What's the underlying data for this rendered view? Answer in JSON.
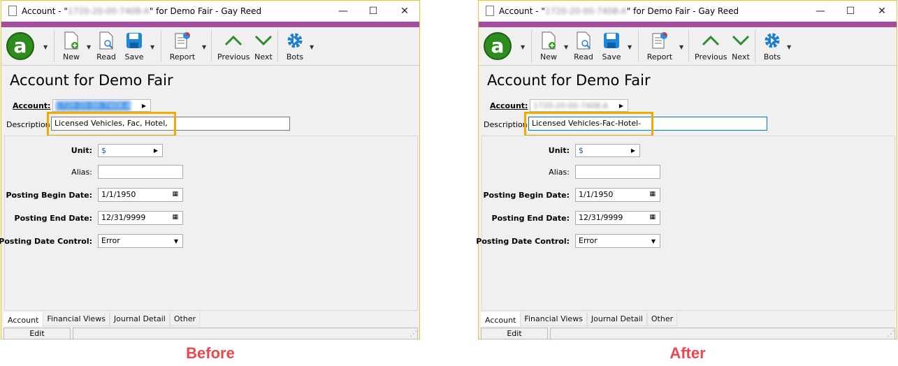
{
  "windows": [
    {
      "title_prefix": "Account - \"",
      "title_account": "1720-20-00-7408-A",
      "title_suffix": "\" for Demo Fair - Gay Reed",
      "toolbar": {
        "new": "New",
        "read": "Read",
        "save": "Save",
        "report": "Report",
        "previous": "Previous",
        "next": "Next",
        "bots": "Bots"
      },
      "heading": "Account for Demo Fair",
      "account_label": "Account:",
      "account_value": "1720-20-00-7408-A",
      "description_label": "Description:",
      "description_value": "Licensed Vehicles, Fac, Hotel,",
      "unit_label": "Unit:",
      "unit_value": "$",
      "alias_label": "Alias:",
      "alias_value": "",
      "begin_label": "Posting Begin Date:",
      "begin_value": "1/1/1950",
      "end_label": "Posting End Date:",
      "end_value": "12/31/9999",
      "control_label": "Posting Date Control:",
      "control_value": "Error",
      "tabs": [
        "Account",
        "Financial Views",
        "Journal Detail",
        "Other"
      ],
      "status_edit": "Edit",
      "caption": "Before",
      "account_selected": true
    },
    {
      "title_prefix": "Account - \"",
      "title_account": "1720-20-00-7408-A",
      "title_suffix": "\" for Demo Fair - Gay Reed",
      "toolbar": {
        "new": "New",
        "read": "Read",
        "save": "Save",
        "report": "Report",
        "previous": "Previous",
        "next": "Next",
        "bots": "Bots"
      },
      "heading": "Account for Demo Fair",
      "account_label": "Account:",
      "account_value": "1720-20-00-7408-A",
      "description_label": "Description:",
      "description_value": "Licensed Vehicles-Fac-Hotel-",
      "unit_label": "Unit:",
      "unit_value": "$",
      "alias_label": "Alias:",
      "alias_value": "",
      "begin_label": "Posting Begin Date:",
      "begin_value": "1/1/1950",
      "end_label": "Posting End Date:",
      "end_value": "12/31/9999",
      "control_label": "Posting Date Control:",
      "control_value": "Error",
      "tabs": [
        "Account",
        "Financial Views",
        "Journal Detail",
        "Other"
      ],
      "status_edit": "Edit",
      "caption": "After",
      "account_selected": false
    }
  ],
  "colors": {
    "accent_purple": "#a54ca0",
    "highlight": "#f5a800",
    "caption": "#f0464b",
    "focus": "#0078d7"
  }
}
